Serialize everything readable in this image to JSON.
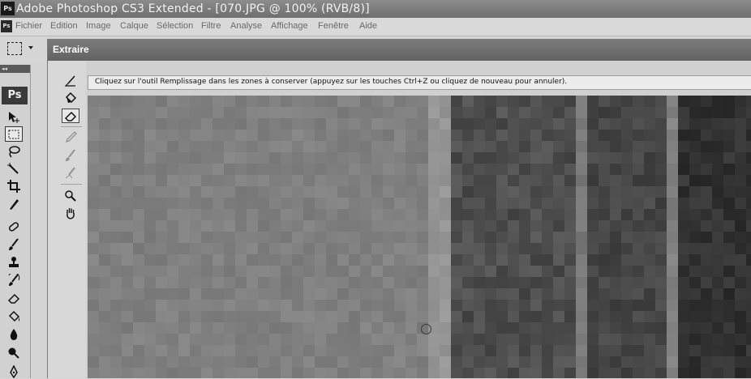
{
  "app": {
    "title": "Adobe Photoshop CS3 Extended - [070.JPG @ 100% (RVB/8)]",
    "icon_label": "Ps"
  },
  "menu": {
    "items": [
      "Fichier",
      "Edition",
      "Image",
      "Calque",
      "Sélection",
      "Filtre",
      "Analyse",
      "Affichage",
      "Fenêtre",
      "Aide"
    ]
  },
  "toolbox": {
    "logo": "Ps",
    "header": "◂◂",
    "tools": [
      "move-tool-icon",
      "rectangular-marquee-icon",
      "lasso-icon",
      "magic-wand-icon",
      "crop-icon",
      "slice-icon",
      "healing-brush-icon",
      "brush-icon",
      "clone-stamp-icon",
      "history-brush-icon",
      "eraser-icon",
      "paint-bucket-icon",
      "blur-icon",
      "dodge-icon",
      "pen-icon"
    ],
    "selected_tool": "rectangular-marquee-icon"
  },
  "dialog": {
    "title": "Extraire",
    "instruction": "Cliquez sur l'outil Remplissage dans les zones à conserver (appuyez sur les touches Ctrl+Z ou cliquez de nouveau pour annuler).",
    "tools": [
      "edge-highlighter-icon",
      "fill-icon",
      "eraser-icon",
      "eyedropper-icon",
      "cleanup-icon",
      "edge-touchup-icon",
      "zoom-icon",
      "hand-icon"
    ],
    "selected_tool": "eraser-icon",
    "disabled_tools": [
      "eyedropper-icon",
      "cleanup-icon",
      "edge-touchup-icon"
    ]
  },
  "colors": {
    "titlebar": "#777777",
    "menubar": "#d9d9d9",
    "dialog_titlebar": "#6e6e6e",
    "instruction_bg": "#ececec"
  }
}
